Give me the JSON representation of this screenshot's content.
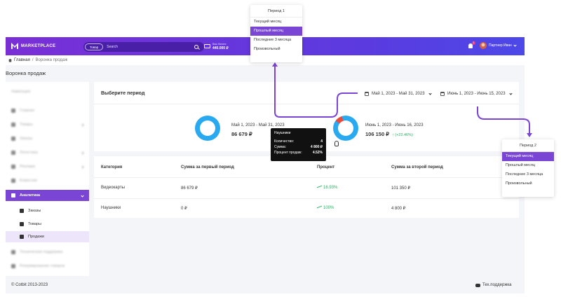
{
  "topbar": {
    "logo_text": "MARKETPLACE",
    "search_category": "Товар",
    "search_placeholder": "Search",
    "balance_label": "Ваш баланс",
    "balance_value": "440.000 ₽",
    "notification_count": "1",
    "user_name": "Партнер Иван"
  },
  "breadcrumb": {
    "home": "Главная",
    "separator": "/",
    "current": "Воронка продаж"
  },
  "page_title": "Воронка продаж",
  "sidebar": {
    "navigation_label": "Навигация",
    "items": [
      "Главная",
      "Товары",
      "Заказы",
      "Логистика",
      "Реклама",
      "Комиссии"
    ],
    "active_item": "Аналитика",
    "sub_items": [
      "Заказы",
      "Товары",
      "Продажи"
    ],
    "bottom_items": [
      "Техническая поддержка",
      "Резервирование товаров"
    ]
  },
  "period_panel": {
    "title": "Выберите период",
    "period1_value": "Май 1, 2023 - Май 31, 2023",
    "period2_value": "Июнь 1, 2023 - Июнь 15, 2023",
    "donut1": {
      "label": "Май 1, 2023 - Май 31, 2023",
      "value": "86 679 ₽"
    },
    "donut2": {
      "label": "Июнь 1, 2023 - Июнь 16, 2023",
      "value": "106 150 ₽",
      "growth": "(+22.46%)"
    }
  },
  "tooltip": {
    "title": "Наушники",
    "rows": [
      {
        "label": "Количество:",
        "value": "4"
      },
      {
        "label": "Сумма:",
        "value": "4 800 ₽"
      },
      {
        "label": "Процент продаж:",
        "value": "4.52%"
      }
    ]
  },
  "table": {
    "headers": [
      "Категория",
      "Сумма за первый период",
      "Процент",
      "Сумма за второй период"
    ],
    "rows": [
      {
        "category": "Видеокарты",
        "sum1": "86 679 ₽",
        "percent": "16.93%",
        "sum2": "101 350 ₽"
      },
      {
        "category": "Наушники",
        "sum1": "0 ₽",
        "percent": "100%",
        "sum2": "4 800 ₽"
      }
    ]
  },
  "footer": {
    "copyright": "© Cotbit 2013-2023",
    "support": "Тех.поддержка"
  },
  "dropdown1": {
    "title": "Период 1",
    "options": [
      "Текущий месяц",
      "Прошлый месяц",
      "Последние 3 месяца",
      "Произвольный"
    ],
    "selected": "Прошлый месяц"
  },
  "dropdown2": {
    "title": "Период 2",
    "options": [
      "Текущий месяц",
      "Прошлый месяц",
      "Последние 3 месяца",
      "Произвольный"
    ],
    "selected": "Текущий месяц"
  },
  "colors": {
    "accent": "#7a44d4",
    "donut": "#29a9f0",
    "donut_highlight": "#e74c3c",
    "positive": "#27ae60"
  }
}
